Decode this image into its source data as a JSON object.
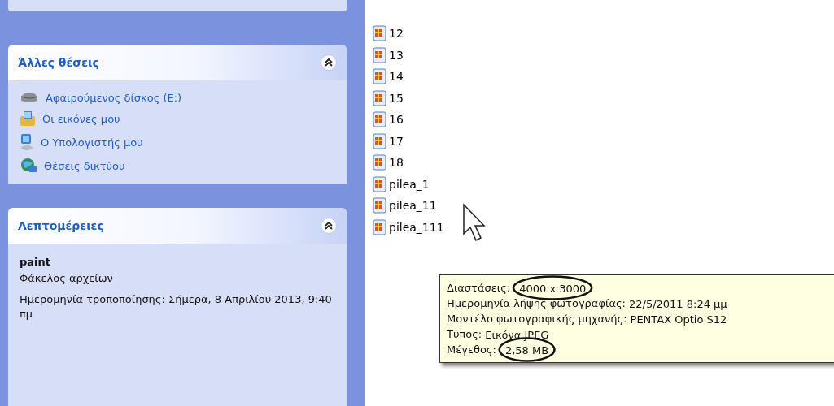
{
  "other_places": {
    "title": "Άλλες θέσεις",
    "expanded": true,
    "items": [
      {
        "kind": "drive",
        "label": "Αφαιρούμενος δίσκος (E:)"
      },
      {
        "kind": "pictures",
        "label": "Οι εικόνες μου"
      },
      {
        "kind": "computer",
        "label": "Ο Υπολογιστής μου"
      },
      {
        "kind": "network",
        "label": "Θέσεις δικτύου"
      }
    ]
  },
  "details": {
    "title": "Λεπτομέρειες",
    "expanded": true,
    "name": "paint",
    "type": "Φάκελος αρχείων",
    "modified": "Ημερομηνία τροποποίησης: Σήμερα, 8 Απριλίου 2013, 9:40 πμ"
  },
  "files": [
    {
      "name": "12"
    },
    {
      "name": "13"
    },
    {
      "name": "14"
    },
    {
      "name": "15"
    },
    {
      "name": "16"
    },
    {
      "name": "17"
    },
    {
      "name": "18"
    },
    {
      "name": "pilea_1"
    },
    {
      "name": "pilea_11"
    },
    {
      "name": "pilea_111"
    }
  ],
  "tooltip": {
    "lines": [
      {
        "label": "Διαστάσεις:",
        "value": "4000 x 3000",
        "circled": true
      },
      {
        "label": "Ημερομηνία λήψης φωτογραφίας:",
        "value": "22/5/2011 8:24 μμ",
        "circled": false
      },
      {
        "label": "Μοντέλο φωτογραφικής μηχανής:",
        "value": "PENTAX Optio S12",
        "circled": false
      },
      {
        "label": "Τύπος:",
        "value": "Εικόνα JPEG",
        "circled": false
      },
      {
        "label": "Μέγεθος:",
        "value": "2,58 MB",
        "circled": true
      }
    ]
  }
}
